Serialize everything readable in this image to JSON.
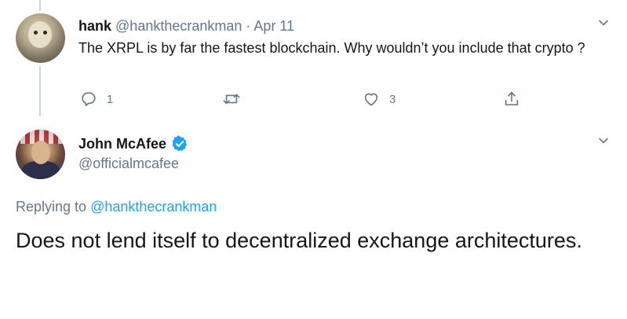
{
  "reply_tweet": {
    "display_name": "hank",
    "handle": "@hankthecrankman",
    "separator": "·",
    "date": "Apr 11",
    "text": "The XRPL is by far the fastest blockchain. Why wouldn’t you include that crypto ?",
    "actions": {
      "reply_count": "1",
      "retweet_count": "",
      "like_count": "3"
    },
    "icons": [
      "reply-icon",
      "retweet-icon",
      "like-icon",
      "share-icon",
      "chevron-down-icon"
    ]
  },
  "main_tweet": {
    "display_name": "John McAfee",
    "verified": true,
    "handle": "@officialmcafee",
    "replying_label": "Replying to",
    "replying_mention": "@hankthecrankman",
    "text": "Does not lend itself to decentralized exchange architectures."
  },
  "colors": {
    "text_primary": "#14171a",
    "text_secondary": "#657786",
    "accent": "#1da1f2",
    "divider": "#ccd6dd"
  }
}
